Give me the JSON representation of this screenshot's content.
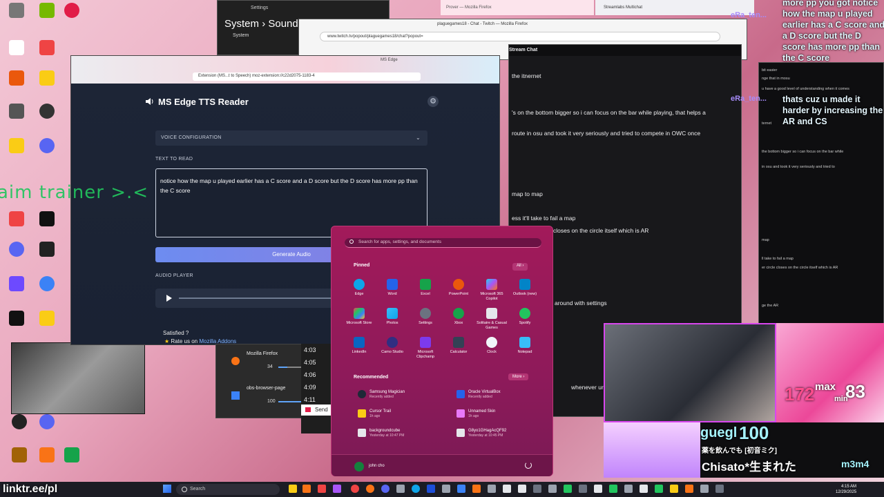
{
  "settings_window": {
    "app": "Settings",
    "crumb_parent": "System",
    "crumb_sep": "›",
    "crumb_child": "Sound",
    "nav_item": "System"
  },
  "twitch_window": {
    "title": "plaguegames18 - Chat - Twitch — Mozilla Firefox",
    "url": "www.twitch.tv/popout/plaguegames18/chat?popout="
  },
  "firefox_top": {
    "title": "Prover — Mozilla Firefox"
  },
  "streamlabs": {
    "title": "Streamlabs Multichat"
  },
  "stream_chat": {
    "header": "Stream Chat",
    "lines": [
      "the itnernet",
      "'s on the bottom bigger so i can focus on the bar while playing, that helps a",
      "route in osu and took it very seriously and tried to compete in OWC once",
      "map to map",
      "ess it'll take to fail a map",
      "closes on the circle itself which is AR",
      "around with settings",
      "whenever ur free"
    ]
  },
  "mini_chat": {
    "lines": [
      "bit easier",
      "nge that in mosu",
      "u have a good level of understanding when it comes",
      "ternet",
      "the bottom bigger so i can focus on the bar while",
      "in osu and took it very seriously and tried to",
      "map",
      "ll take to fail a map",
      "er circle closes on the circle itself which is AR",
      "ge the AR"
    ]
  },
  "overlay": {
    "aim_text": "aim trainer >.<"
  },
  "top_right_chat": {
    "user1": "eRa_ten...",
    "msg1": "more pp you got notice how the map u played earlier has a C score and a D score but the D score has more pp than the C score",
    "user2": "eRa_ten...",
    "msg2": "thats cuz u made it harder by increasing the AR and CS"
  },
  "tts": {
    "tab_label": "MS Edge",
    "url": "Extension (MS...t to Speech)   moz-extension://c22d2075-1183-4",
    "title": "MS Edge TTS Reader",
    "voice_config": "VOICE CONFIGURATION",
    "text_label": "TEXT TO READ",
    "text_value": "notice how the map u played earlier has a C score and a D score but the D score has more pp than the C score",
    "generate": "Generate Audio",
    "audio_label": "AUDIO PLAYER",
    "satisfied": "Satisfied ?",
    "rate_prefix": "Rate us on",
    "rate_link": "Mozilla Addons"
  },
  "mixer": {
    "apps": [
      {
        "name": "Mozilla Firefox",
        "volume": "34"
      },
      {
        "name": "obs-browser-page",
        "volume": "100"
      }
    ]
  },
  "times": [
    "4:03",
    "4:05",
    "4:06",
    "4:09",
    "4:11"
  ],
  "send_label": "Send",
  "start_menu": {
    "search_placeholder": "Search for apps, settings, and documents",
    "pinned": "Pinned",
    "all": "All",
    "apps": [
      [
        "Edge",
        "Word",
        "Excel",
        "PowerPoint",
        "Microsoft 365 Copilot",
        "Outlook (new)"
      ],
      [
        "Microsoft Store",
        "Photos",
        "Settings",
        "Xbox",
        "Solitaire & Casual Games",
        "Spotify"
      ],
      [
        "LinkedIn",
        "Camo Studio",
        "Microsoft Clipchamp",
        "Calculator",
        "Clock",
        "Notepad"
      ]
    ],
    "recommended": "Recommended",
    "more": "More",
    "recs": [
      {
        "name": "Samsung Magician",
        "sub": "Recently added"
      },
      {
        "name": "Oracle VirtualBox",
        "sub": "Recently added"
      },
      {
        "name": "Cursor Trail",
        "sub": "1h ago"
      },
      {
        "name": "Unnamed Skin",
        "sub": "1h ago"
      },
      {
        "name": "backgroundcube",
        "sub": "Yesterday at 10:47 PM"
      },
      {
        "name": "G8yo1GHagAcQF92",
        "sub": "Yesterday at 10:45 PM"
      }
    ],
    "user": "john cho"
  },
  "stats": {
    "pp": "172",
    "max": "max",
    "val83": "83",
    "min": "min",
    "score": "100",
    "tag": "m3m4",
    "jp_line1": "薬を飲んでも [初音ミク]",
    "jp_line2": "Chisato*生まれた",
    "label": "guegl"
  },
  "taskbar": {
    "search": "Search",
    "time": "4:15 AM",
    "date": "12/29/2025"
  },
  "linktree": "linktr.ee/pl",
  "colors": {
    "start_bg": "#a21a5a",
    "tts_bg": "#1b2232",
    "accent": "#6d8cf0",
    "overlay_green": "#22c55e"
  }
}
